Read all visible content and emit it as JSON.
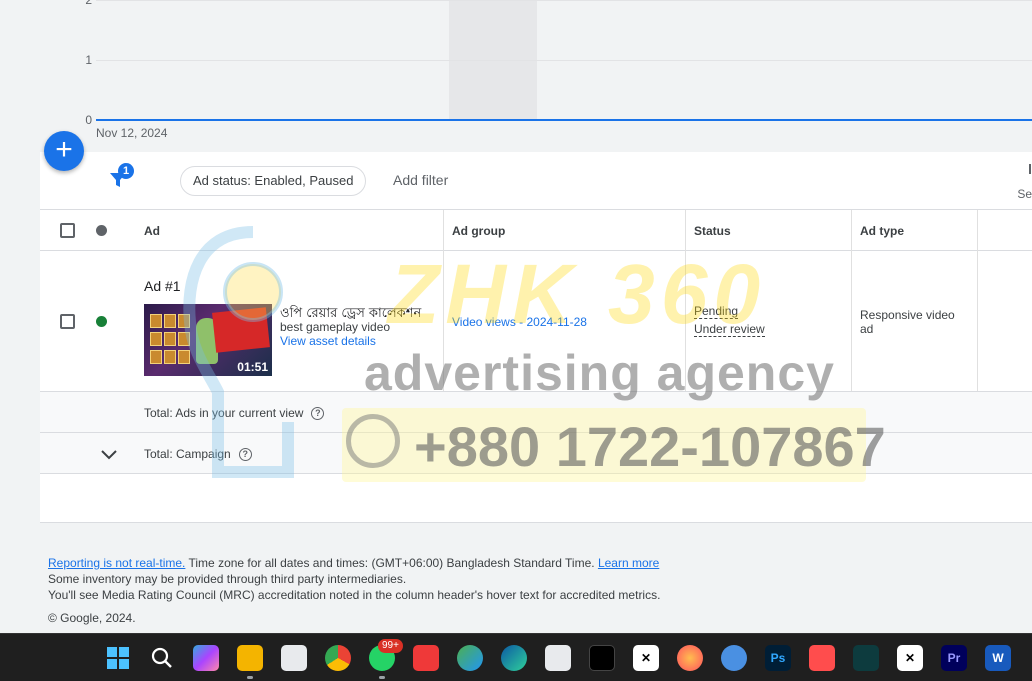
{
  "chart": {
    "y_ticks": [
      "2",
      "1",
      "0"
    ],
    "x_start_date": "Nov 12, 2024",
    "line_color": "#1a73e8"
  },
  "fab": {
    "icon": "plus-icon",
    "label": "+"
  },
  "filter_bar": {
    "filter_count": "1",
    "chip_label": "Ad status: Enabled, Paused",
    "add_filter_label": "Add filter",
    "right_clip_label": "Se"
  },
  "table": {
    "headers": {
      "ad": "Ad",
      "ad_group": "Ad group",
      "status": "Status",
      "ad_type": "Ad type"
    },
    "rows": [
      {
        "ad_name": "Ad #1",
        "video_duration": "01:51",
        "title": "ওপি রেয়ার ড্রেস কালেকশন",
        "subtitle": "best gameplay video",
        "link": "View asset details",
        "ad_group": "Video views - 2024-11-28",
        "status_1": "Pending",
        "status_2": "Under review",
        "ad_type": "Responsive video ad",
        "status_color": "#188038"
      }
    ],
    "totals": {
      "current_view": "Total: Ads in your current view",
      "campaign": "Total: Campaign"
    }
  },
  "watermark": {
    "brand": "ZHK 360",
    "tagline": "advertising agency",
    "phone": "+880 1722-107867"
  },
  "footer": {
    "not_realtime": "Reporting is not real-time.",
    "timezone": " Time zone for all dates and times: (GMT+06:00) Bangladesh Standard Time. ",
    "learn_more": "Learn more",
    "line2": "Some inventory may be provided through third party intermediaries.",
    "line3": "You'll see Media Rating Council (MRC) accreditation noted in the column header's hover text for accredited metrics.",
    "copyright": "© Google, 2024."
  },
  "taskbar": {
    "whatsapp_badge": "99+",
    "photoshop": "Ps",
    "premiere": "Pr",
    "word": "W"
  }
}
